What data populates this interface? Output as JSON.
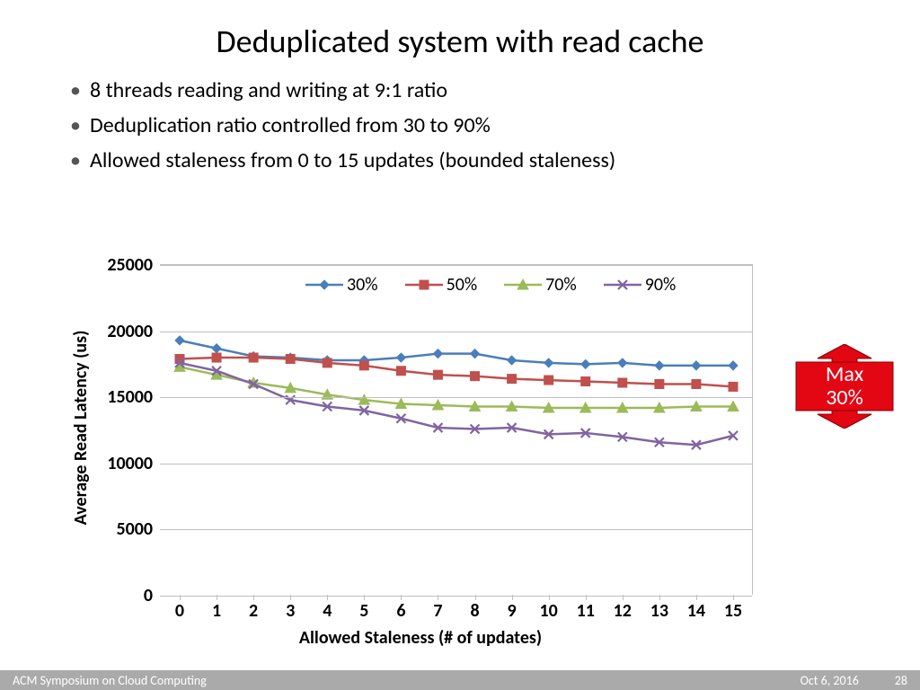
{
  "title": "Deduplicated system with read cache",
  "bullets": {
    "b1": "8 threads reading and writing at 9:1 ratio",
    "b2": "Deduplication ratio controlled from 30 to 90%",
    "b3": "Allowed staleness from 0 to 15 updates (bounded staleness)"
  },
  "chart_data": {
    "type": "line",
    "title": "",
    "xlabel": "Allowed Staleness (# of updates)",
    "ylabel": "Average Read Latency (us)",
    "ylim": [
      0,
      25000
    ],
    "yticks": [
      0,
      5000,
      10000,
      15000,
      20000,
      25000
    ],
    "categories": [
      0,
      1,
      2,
      3,
      4,
      5,
      6,
      7,
      8,
      9,
      10,
      11,
      12,
      13,
      14,
      15
    ],
    "series": [
      {
        "name": "30%",
        "color": "#4a7ebb",
        "marker": "diamond",
        "values": [
          19300,
          18700,
          18100,
          18000,
          17800,
          17800,
          18000,
          18300,
          18300,
          17800,
          17600,
          17500,
          17600,
          17400,
          17400,
          17400
        ]
      },
      {
        "name": "50%",
        "color": "#c0504d",
        "marker": "square",
        "values": [
          17900,
          18000,
          18000,
          17900,
          17600,
          17400,
          17000,
          16700,
          16600,
          16400,
          16300,
          16200,
          16100,
          16000,
          16000,
          15800
        ]
      },
      {
        "name": "70%",
        "color": "#9bbb59",
        "marker": "triangle",
        "values": [
          17300,
          16700,
          16100,
          15700,
          15200,
          14800,
          14500,
          14400,
          14300,
          14300,
          14200,
          14200,
          14200,
          14200,
          14300,
          14300
        ]
      },
      {
        "name": "90%",
        "color": "#8064a2",
        "marker": "cross",
        "values": [
          17600,
          17000,
          16000,
          14800,
          14300,
          14000,
          13400,
          12700,
          12600,
          12700,
          12200,
          12300,
          12000,
          11600,
          11400,
          12100
        ]
      }
    ],
    "legend_position": "top"
  },
  "annotation": {
    "line1": "Max",
    "line2": "30%"
  },
  "footer": {
    "venue": "ACM Symposium on Cloud Computing",
    "date": "Oct 6, 2016",
    "page": "28"
  }
}
